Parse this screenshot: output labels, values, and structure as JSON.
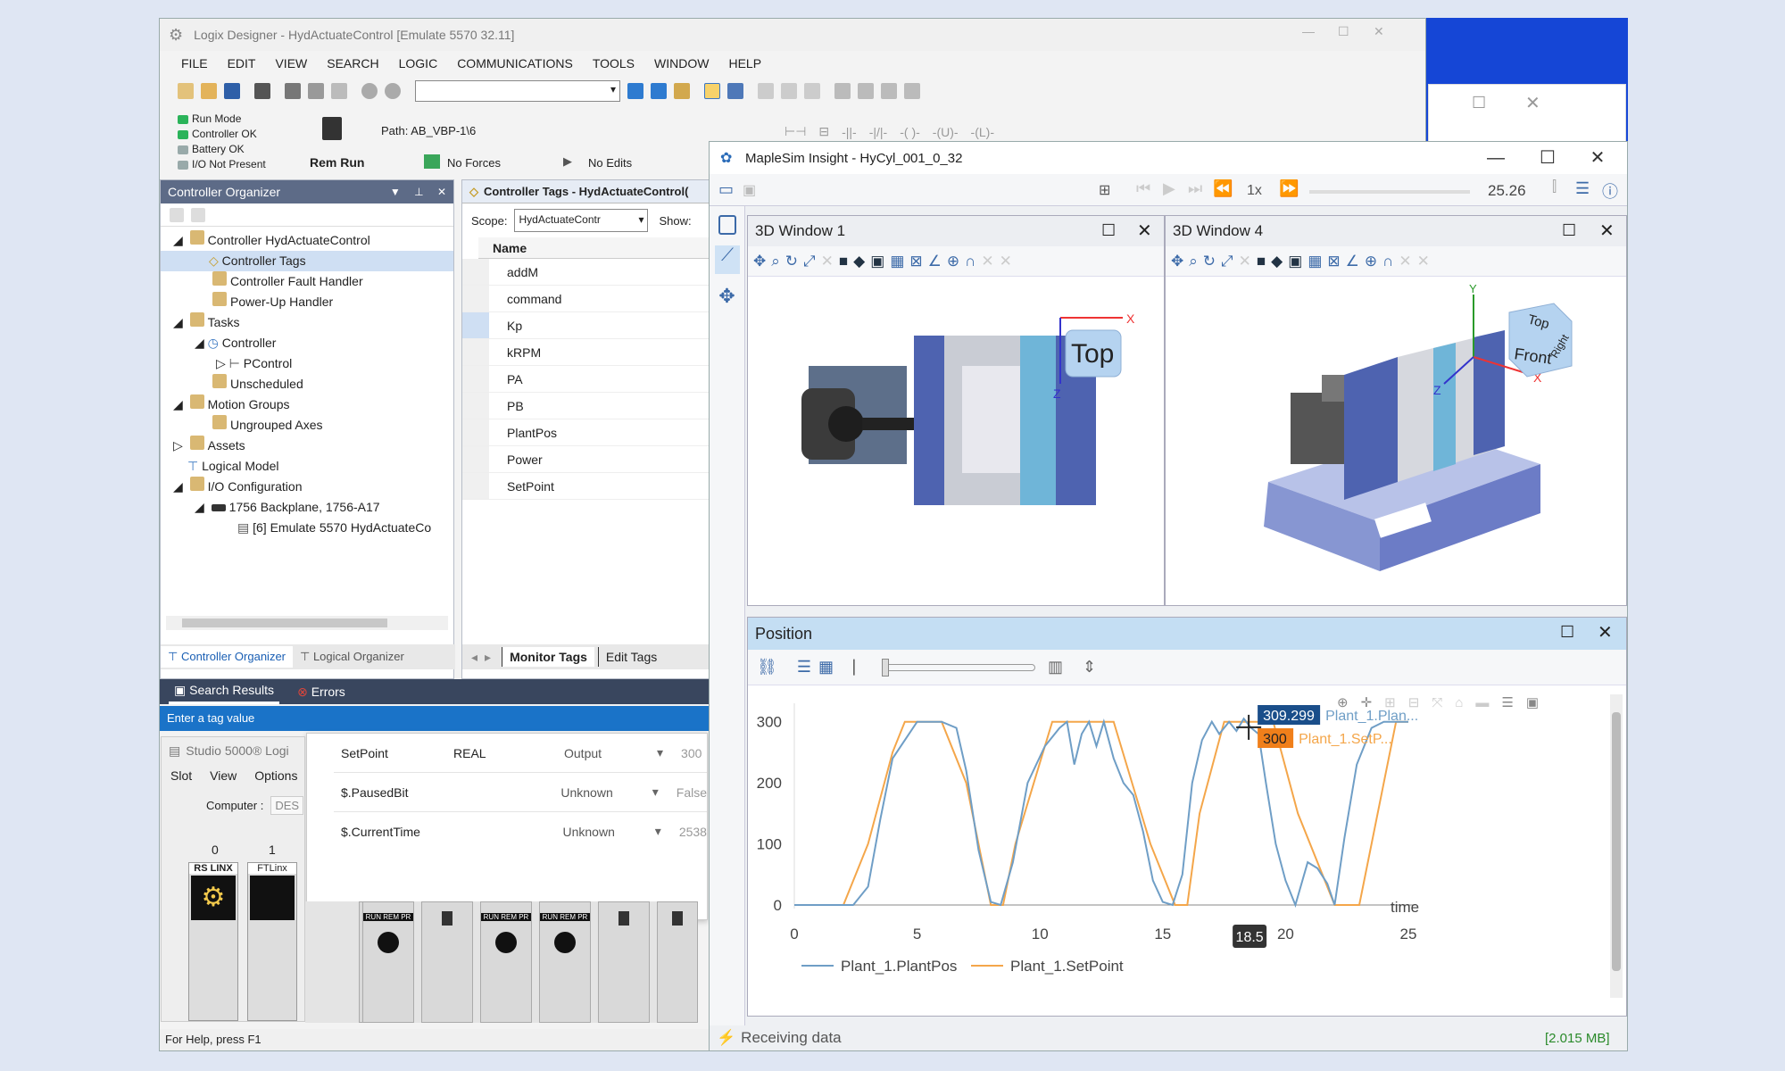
{
  "logix": {
    "title": "Logix Designer - HydActuateControl [Emulate 5570 32.11]",
    "menu": [
      "FILE",
      "EDIT",
      "VIEW",
      "SEARCH",
      "LOGIC",
      "COMMUNICATIONS",
      "TOOLS",
      "WINDOW",
      "HELP"
    ],
    "status": [
      "Run Mode",
      "Controller OK",
      "Battery OK",
      "I/O Not Present"
    ],
    "path_label": "Path: AB_VBP-1\\6",
    "rem_run": "Rem Run",
    "no_forces": "No Forces",
    "no_edits": "No Edits",
    "organizer_title": "Controller Organizer",
    "tree": [
      {
        "label": "Controller HydActuateControl",
        "level": 0
      },
      {
        "label": "Controller Tags",
        "level": 1
      },
      {
        "label": "Controller Fault Handler",
        "level": 1
      },
      {
        "label": "Power-Up Handler",
        "level": 1
      },
      {
        "label": "Tasks",
        "level": 0
      },
      {
        "label": "Controller",
        "level": 1
      },
      {
        "label": "PControl",
        "level": 2
      },
      {
        "label": "Unscheduled",
        "level": 1
      },
      {
        "label": "Motion Groups",
        "level": 0
      },
      {
        "label": "Ungrouped Axes",
        "level": 1
      },
      {
        "label": "Assets",
        "level": 0
      },
      {
        "label": "Logical Model",
        "level": 0
      },
      {
        "label": "I/O Configuration",
        "level": 0
      },
      {
        "label": "1756 Backplane, 1756-A17",
        "level": 1
      },
      {
        "label": "[6] Emulate 5570 HydActuateCo",
        "level": 2
      }
    ],
    "org_tabs": [
      "Controller Organizer",
      "Logical Organizer"
    ],
    "tags_title": "Controller Tags - HydActuateControl(",
    "scope_label": "Scope:",
    "scope_value": "HydActuateContr",
    "show_label": "Show:",
    "name_header": "Name",
    "tags": [
      "addM",
      "command",
      "Kp",
      "kRPM",
      "PA",
      "PB",
      "PlantPos",
      "Power",
      "SetPoint"
    ],
    "tag_tabs": [
      "Monitor Tags",
      "Edit Tags"
    ],
    "bottom_tabs": [
      "Search Results",
      "Errors"
    ],
    "enter_tag": "Enter a tag value",
    "tag_rows": [
      {
        "name": "SetPoint",
        "type": "REAL",
        "usage": "Output",
        "value": "300"
      },
      {
        "name": "$.PausedBit",
        "type": "",
        "usage": "Unknown",
        "value": "False"
      },
      {
        "name": "$.CurrentTime",
        "type": "",
        "usage": "Unknown",
        "value": "2538"
      }
    ],
    "status_bar": "For Help, press F1"
  },
  "studio": {
    "title": "Studio 5000® Logi",
    "menu": [
      "Slot",
      "View",
      "Options"
    ],
    "computer_label": "Computer :",
    "computer_value": "DES",
    "slots": [
      "0",
      "1"
    ],
    "modules": [
      "RS LINX",
      "FTLinx"
    ],
    "module_status": "RUN REM PR"
  },
  "maplesim": {
    "title": "MapleSim Insight - HyCyl_001_0_32",
    "speed": "1x",
    "time_value": "25.26",
    "window1_title": "3D Window 1",
    "window4_title": "3D Window 4",
    "view_labels": {
      "top": "Top",
      "front": "Front",
      "right": "Right",
      "x": "X",
      "y": "Y",
      "z": "Z"
    },
    "plot_title": "Position",
    "status": "Receiving data",
    "mem": "[2.015 MB]",
    "cursor_x_label": "18.5",
    "tip1": "309.299",
    "tip1_name": "Plant_1.Plan...",
    "tip2": "300",
    "tip2_name": "Plant_1.SetP..."
  },
  "colors": {
    "plantpos": "#6f9ec6",
    "setpoint": "#f4a64a",
    "accent": "#1a73c8",
    "organizer_bar": "#5d6b87"
  },
  "chart_data": {
    "type": "line",
    "xlabel": "time",
    "xlim": [
      0,
      25
    ],
    "ylim": [
      0,
      300
    ],
    "xticks": [
      0,
      5,
      10,
      15,
      20,
      25
    ],
    "yticks": [
      0,
      100,
      200,
      300
    ],
    "legend_position": "bottom",
    "series": [
      {
        "name": "Plant_1.PlantPos",
        "color": "#6f9ec6",
        "x": [
          0,
          1.4,
          2.4,
          3.0,
          3.5,
          4.0,
          5.0,
          6.0,
          6.6,
          7.0,
          7.5,
          8.0,
          8.4,
          8.9,
          9.5,
          10.2,
          10.8,
          11.1,
          11.4,
          11.7,
          12.0,
          12.3,
          12.6,
          13.0,
          13.4,
          13.8,
          14.2,
          14.6,
          15.0,
          15.4,
          15.8,
          16.2,
          16.6,
          17.0,
          17.3,
          17.7,
          18.0,
          18.3,
          18.6,
          18.9,
          19.2,
          19.6,
          20.0,
          20.4,
          20.9,
          21.3,
          21.7,
          22.0,
          22.4,
          22.9,
          23.5,
          24.0,
          24.5,
          25.0
        ],
        "y": [
          0,
          0,
          0,
          30,
          140,
          240,
          300,
          300,
          290,
          220,
          90,
          5,
          0,
          70,
          200,
          260,
          290,
          300,
          230,
          280,
          300,
          260,
          300,
          240,
          200,
          180,
          120,
          40,
          5,
          0,
          50,
          200,
          270,
          300,
          280,
          300,
          285,
          305,
          290,
          280,
          200,
          100,
          40,
          0,
          70,
          60,
          35,
          0,
          110,
          230,
          290,
          300,
          300,
          300
        ]
      },
      {
        "name": "Plant_1.SetPoint",
        "color": "#f4a64a",
        "x": [
          0,
          1.5,
          2.0,
          3.0,
          4.0,
          4.5,
          6.0,
          7.0,
          8.0,
          8.5,
          9.0,
          10.5,
          11.0,
          13.0,
          14.5,
          15.5,
          16.0,
          16.5,
          17.5,
          19.5,
          20.5,
          22.0,
          23.0,
          24.5,
          25.0
        ],
        "y": [
          0,
          0,
          0,
          100,
          250,
          300,
          300,
          200,
          0,
          0,
          100,
          300,
          300,
          300,
          100,
          0,
          0,
          150,
          300,
          300,
          150,
          0,
          0,
          300,
          300
        ]
      }
    ]
  }
}
